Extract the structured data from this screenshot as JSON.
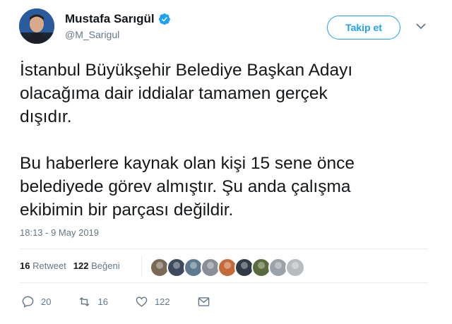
{
  "author": {
    "name": "Mustafa Sarıgül",
    "handle": "@M_Sarigul",
    "verified": true
  },
  "follow_button": {
    "label": "Takip et"
  },
  "tweet": {
    "text": "İstanbul Büyükşehir Belediye Başkan Adayı\nolacağıma dair iddialar tamamen gerçek\ndışıdır.\n\nBu haberlere kaynak olan kişi 15 sene önce\nbelediyede görev almıştır. Şu anda çalışma\nekibimin bir parçası değildir.",
    "timestamp": "18:13 - 9 May 2019"
  },
  "stats": {
    "retweets_count": "16",
    "retweets_label": "Retweet",
    "likes_count": "122",
    "likes_label": "Beğeni"
  },
  "liker_avatars": [
    {
      "color": "#7a6a55"
    },
    {
      "color": "#3c4a5c"
    },
    {
      "color": "#5e7a8e"
    },
    {
      "color": "#8a8f96"
    },
    {
      "color": "#c46b3a"
    },
    {
      "color": "#2f3a46"
    },
    {
      "color": "#5a6b3e"
    },
    {
      "color": "#9aa2aa"
    },
    {
      "color": "#b8bcbf"
    }
  ],
  "actions": {
    "reply_count": "20",
    "retweet_count": "16",
    "like_count": "122"
  },
  "colors": {
    "accent": "#1da1f2",
    "muted": "#657786",
    "text": "#14171a"
  }
}
